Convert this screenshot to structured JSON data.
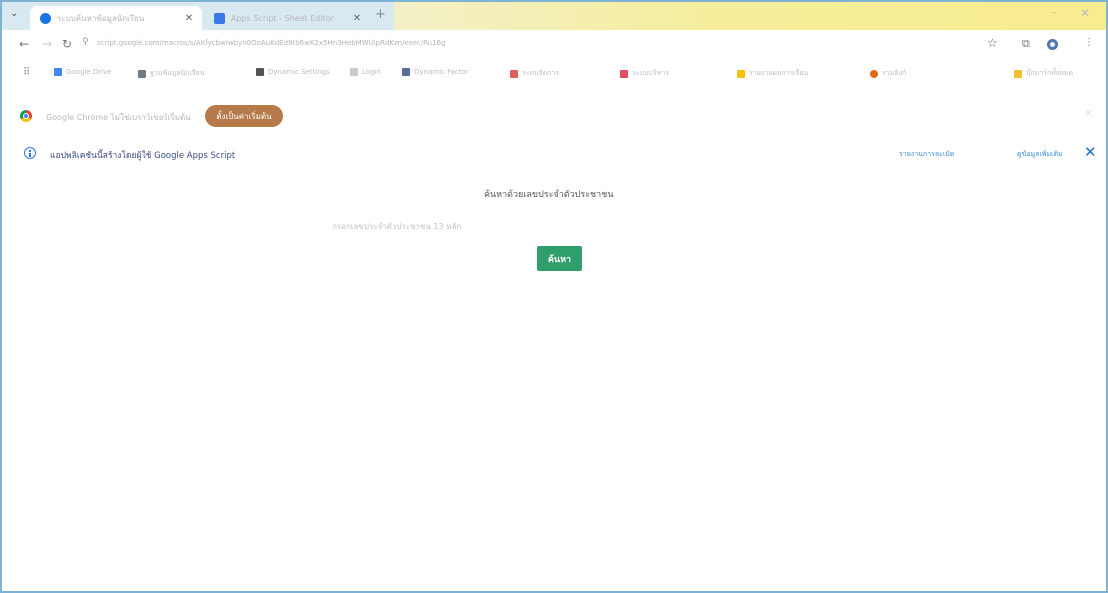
{
  "browser": {
    "tabs": [
      {
        "title": "ระบบค้นหาข้อมูลนักเรียน",
        "favicon_color": "#1a73e8",
        "active": true
      },
      {
        "title": "Apps Script - Sheet Editor",
        "favicon_color": "#3b78e7",
        "active": false
      }
    ],
    "address": {
      "url": "script.google.com/macros/s/AKfycbwIwbyn0OoAuKdEd9tb6wK2x5Hn3HebMWUlpRdKzn/exec/Ru16g"
    },
    "bookmarks": [
      {
        "label": "Google Drive",
        "icon_color": "#4285f4"
      },
      {
        "label": "ฐานข้อมูลนักเรียน",
        "icon_color": "#6d7d8b"
      },
      {
        "label": "Dynamic Settings",
        "icon_color": "#555555"
      },
      {
        "label": "Login",
        "icon_color": "#cccccc"
      },
      {
        "label": "Dynamic Factor",
        "icon_color": "#5a6a9a"
      },
      {
        "label": "ระบบจัดการ",
        "icon_color": "#e06060"
      },
      {
        "label": "ระบบบริหาร",
        "icon_color": "#e05060"
      },
      {
        "label": "รายงานผลการเรียน",
        "icon_color": "#f4c20d"
      },
      {
        "label": "รวมลิงก์",
        "icon_color": "#e06a1a"
      },
      {
        "label": "บุ๊กมาร์กทั้งหมด",
        "icon_color": "#f0c030"
      }
    ]
  },
  "default_bar": {
    "text": "Google Chrome ไม่ใช่เบราว์เซอร์เริ่มต้น",
    "button_label": "ตั้งเป็นค่าเริ่มต้น"
  },
  "notice_bar": {
    "text": "แอปพลิเคชันนี้สร้างโดยผู้ใช้ Google Apps Script",
    "link_report": "รายงานการละเมิด",
    "link_learn": "ดูข้อมูลเพิ่มเติม"
  },
  "page": {
    "heading": "ค้นหาด้วยเลขประจำตัวประชาชน",
    "input_placeholder": "กรอกเลขประจำตัวประชาชน 13 หลัก",
    "search_button": "ค้นหา"
  },
  "colors": {
    "accent_button": "#2f9e6b",
    "default_button": "#b5794a",
    "info_blue": "#2f78d8"
  }
}
